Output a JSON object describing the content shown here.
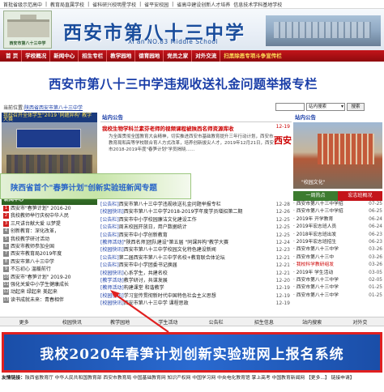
{
  "topstrip": [
    "首批省级示范高中",
    "|",
    "教育局直属学校",
    "|",
    "省科研兴校明星学校",
    "|",
    "省平安校园",
    "|",
    "省高中建设创新人才培养",
    "信息技术学科基地学校"
  ],
  "banner": {
    "school_name": "西安市第八十三中学",
    "school_en": "Xi'an NO.83 Middle School",
    "logo_text": "西安市第八十三中学"
  },
  "nav": [
    {
      "label": "首 页",
      "hot": false
    },
    {
      "label": "学校概况",
      "hot": false
    },
    {
      "label": "新闻中心",
      "hot": false
    },
    {
      "label": "招生专栏",
      "hot": false
    },
    {
      "label": "教学园地",
      "hot": false
    },
    {
      "label": "德育园地",
      "hot": false
    },
    {
      "label": "党员之家",
      "hot": false
    },
    {
      "label": "对外交流",
      "hot": false
    },
    {
      "label": "扫黑除恶专项斗争宣传栏",
      "hot": true
    }
  ],
  "headline": "西安市第八十三中学违规收送礼金问题举报专栏",
  "locbar": {
    "label": "当前位置:",
    "path": "陕西省西安市第八十三中学",
    "search_placeholder": "",
    "select_value": "站内搜索",
    "button": "搜索"
  },
  "left": {
    "photo_caption": "我校召开全体学生\"2019 '同题异构' 教学大赛",
    "side_title": "新闻中心",
    "items": [
      {
        "n": "1",
        "text": "西安市\"春笋计划\" 2016-20",
        "hot": true
      },
      {
        "n": "2",
        "text": "我校教师举行庆祝中华人民",
        "hot": true
      },
      {
        "n": "3",
        "text": "三尺讲台献大爱 以梦提",
        "hot": true
      },
      {
        "n": "4",
        "text": "创新教育：深化改革，",
        "hot": false
      },
      {
        "n": "5",
        "text": "我校教学研讨活动",
        "hot": false
      },
      {
        "n": "6",
        "text": "西安市教师参加全国",
        "hot": false
      },
      {
        "n": "7",
        "text": "西安市教育局2019年度",
        "hot": false
      },
      {
        "n": "8",
        "text": "西安市第八十三中学",
        "hot": false
      },
      {
        "n": "9",
        "text": "不忘初心 温暖前行",
        "hot": false
      },
      {
        "n": "10",
        "text": "西安市\"春笋计划\" 2019-20",
        "hot": false
      },
      {
        "n": "11",
        "text": "强化关爱中小学生健康成长",
        "hot": false
      },
      {
        "n": "12",
        "text": "动起来 绿起来 美起来",
        "hot": false
      },
      {
        "n": "13",
        "text": "读书成就未来：青春相伴",
        "hot": false
      }
    ]
  },
  "mid": {
    "head": "站内公告",
    "top_title": "我校生物学科兰素芬老师的视频课程被陕西名师资源库收",
    "top_date": "12-19",
    "top_mark": "西安",
    "top_para": "为全面贯彻全国教育大会精神，切实推进西安市基础教育提升三年行动计划，西安市教育局和高等学校联合育人方式改革，培养创新拔尖人才，2019年12月21日，西安市2018-2019年度\"春笋计划\"学员揭晓……",
    "spring_title": "陕西省首个\"春笋计划\"创新实验班新闻专题",
    "list": [
      {
        "cat": "[公告栏]",
        "text": "西安市第八十三中学违规收送礼金问题举报专栏",
        "date": "12-28"
      },
      {
        "cat": "[校园快讯]",
        "text": "西安市第八十三中学2018-2019学年度学员增招第二期",
        "date": "12-26"
      },
      {
        "cat": "[公告栏]",
        "text": "西安市中小学校园廉洁文化建设工作",
        "date": "12-25"
      },
      {
        "cat": "[公告栏]",
        "text": "周末校园开放日，用户数据统计",
        "date": "12-25"
      },
      {
        "cat": "[公告栏]",
        "text": "西安市中小学创新教育",
        "date": "12-25"
      },
      {
        "cat": "[教师活动]",
        "text": "\"陕西名师]团队建设\"第五届 \"同课异构\"教学大赛",
        "date": "12-24"
      },
      {
        "cat": "[校园快讯]",
        "text": "西安市第八十三中学校园文化特色建设新闻",
        "date": "12-23"
      },
      {
        "cat": "[公告栏]",
        "text": "第二届西安市第八十三中学名校+教育联合体论坛",
        "date": "12-21"
      },
      {
        "cat": "[公告栏]",
        "text": "西安市中小学团委书记换届",
        "date": "12-21"
      },
      {
        "cat": "[校园快讯]",
        "text": "心系学生，共建名校",
        "date": "12-21"
      },
      {
        "cat": "[教学活动]",
        "text": "教学研讨，共谋发展",
        "date": "12-20"
      },
      {
        "cat": "[教师活动]",
        "text": "构建课堂 和谐教学",
        "date": "12-19"
      },
      {
        "cat": "[校园快讯]",
        "text": "学习宣传贯彻新时代中国特色社会主义思想",
        "date": "12-19"
      },
      {
        "cat": "[校园快讯]",
        "text": "西安市第八十三中学 课程思政",
        "date": "12-19"
      }
    ]
  },
  "right": {
    "head": "站内公告",
    "photo_watermark": "\"校园文化\"",
    "tabs": [
      "一周热点",
      "宏志班概况"
    ],
    "list": [
      {
        "text": "西安市第八十三中学招",
        "date": "07-25",
        "red": false
      },
      {
        "text": "西安市第八十三中学招",
        "date": "06-25",
        "red": false
      },
      {
        "text": "2019年 开学教育",
        "date": "06-24",
        "red": false
      },
      {
        "text": "2019年宏志班人员",
        "date": "06-24",
        "red": false
      },
      {
        "text": "2018年宏志班出发",
        "date": "06-23",
        "red": false
      },
      {
        "text": "2019年宏志班招生",
        "date": "06-23",
        "red": false
      },
      {
        "text": "西安市第八十三中学",
        "date": "03-26",
        "red": false
      },
      {
        "text": "西安市第八十三中",
        "date": "03-26",
        "red": false
      },
      {
        "text": "我校科学教研组发",
        "date": "03-26",
        "red": true
      },
      {
        "text": "2019年 学生活动",
        "date": "03-05",
        "red": false
      },
      {
        "text": "西安市第八十三中学",
        "date": "02-05",
        "red": false
      },
      {
        "text": "西安市第八十三中学",
        "date": "01-25",
        "red": false
      },
      {
        "text": "西安市第八十三中学",
        "date": "01-25",
        "red": false
      }
    ]
  },
  "bottom_tabs": [
    "更多",
    "校园快讯",
    "教学园地",
    "学生活动",
    "公告栏",
    "招生信息",
    "站内搜索",
    "对外交"
  ],
  "promo": "我校2020年春笋计划创新实验班网上报名系统",
  "footer": {
    "label": "友情链接：",
    "links": "陕西省教育厅 中华人民共和国教育部 西安市教育局 中国基础教育网 知识产权网 中国学习网 中央电化教育馆 掌上高考 中国教育新闻网 【更多...】 链接申请】"
  },
  "colors": {
    "nav_red": "#c4141a",
    "title_blue": "#1a3ea8",
    "green": "#3c7b2f",
    "promo_border": "#e02020"
  }
}
